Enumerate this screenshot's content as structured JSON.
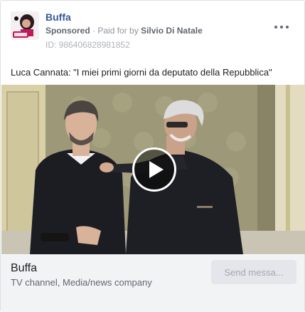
{
  "ad": {
    "page_name": "Buffa",
    "sponsored_label": "Sponsored",
    "separator": "·",
    "paid_prefix": "Paid for by",
    "paid_by": "Silvio Di Natale",
    "ad_id": "ID: 986406828981852",
    "more_icon": "more-horizontal-icon",
    "caption": "Luca Cannata: \"I miei primi giorni da deputato della Repubblica\"",
    "play_icon": "play-icon"
  },
  "footer": {
    "name": "Buffa",
    "category": "TV channel, Media/news company",
    "send_button": "Send messa..."
  },
  "colors": {
    "link": "#385898",
    "footer_bg": "#f2f3f5",
    "button_bg": "#e4e6eb"
  }
}
